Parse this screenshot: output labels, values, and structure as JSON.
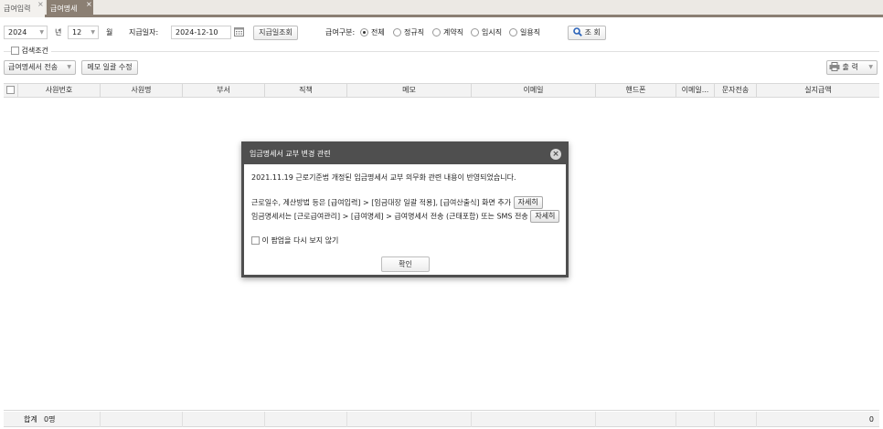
{
  "tabs": [
    {
      "label": "급여입력",
      "close": "×"
    },
    {
      "label": "급여명세",
      "close": "×"
    }
  ],
  "filters": {
    "year_value": "2024",
    "year_label": "년",
    "month_value": "12",
    "month_label": "월",
    "pay_date_label": "지급일자:",
    "pay_date_value": "2024-12-10",
    "pay_date_lookup_button": "지급일조회",
    "pay_type_label": "급여구분:",
    "radios": [
      {
        "label": "전체",
        "checked": true
      },
      {
        "label": "정규직",
        "checked": false
      },
      {
        "label": "계약직",
        "checked": false
      },
      {
        "label": "임시직",
        "checked": false
      },
      {
        "label": "일용직",
        "checked": false
      }
    ],
    "search_button": "조 회",
    "search_condition_label": "검색조건"
  },
  "toolbar": {
    "send_statement": "급여명세서 전송",
    "memo_bulk_edit": "메모 일괄 수정",
    "print": "출 력"
  },
  "grid": {
    "columns": [
      "사원번호",
      "사원명",
      "부서",
      "직책",
      "메모",
      "이메일",
      "핸드폰",
      "이메일...",
      "문자전송",
      "실지급액"
    ],
    "rows": [],
    "footer": {
      "total_label": "합계",
      "count": "0명",
      "amount": "0"
    }
  },
  "modal": {
    "title": "임금명세서 교부 변경 관련",
    "line1": "2021.11.19 근로기준법 개정된 임금명세서 교부 의무화 관련 내용이 반영되었습니다.",
    "line2": "근로일수, 계산방법 등은 [급여입력] > [임금대장 일괄 적용], [급여산출식] 화면 추가",
    "line3": "임금명세서는 [근로급여관리] > [급여명세] > 급여명세서 전송 (근태포함) 또는 SMS 전송",
    "detail_button": "자세히",
    "no_show_label": "이 팝업을 다시 보지 않기",
    "confirm_button": "확인"
  },
  "colors": {
    "tab_active": "#8b7f73",
    "modal_header": "#4f4f4f",
    "search_icon": "#2a62b8"
  }
}
